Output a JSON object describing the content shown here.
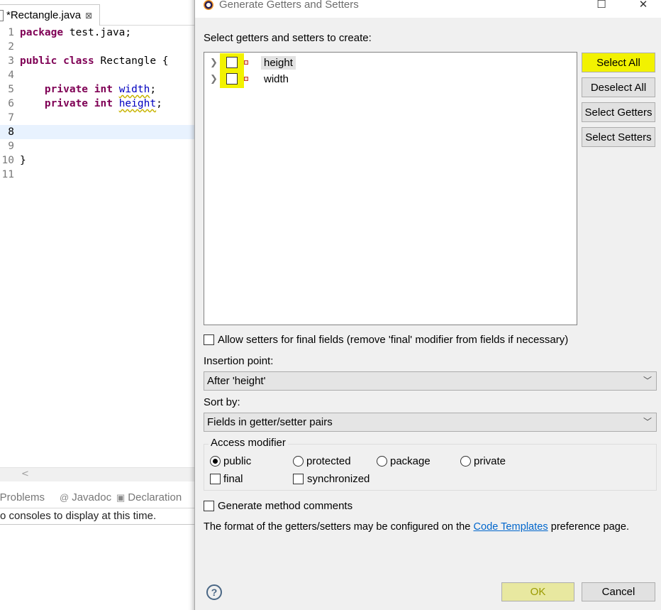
{
  "editor": {
    "tab_label": "*Rectangle.java",
    "tab_close": "⊠",
    "lines": [
      {
        "n": "1",
        "parts": [
          {
            "t": "package",
            "c": "kw"
          },
          {
            "t": " test.java;",
            "c": ""
          }
        ]
      },
      {
        "n": "2",
        "parts": []
      },
      {
        "n": "3",
        "parts": [
          {
            "t": "public",
            "c": "kw"
          },
          {
            "t": " ",
            "c": ""
          },
          {
            "t": "class",
            "c": "kw"
          },
          {
            "t": " Rectangle {",
            "c": ""
          }
        ]
      },
      {
        "n": "4",
        "parts": []
      },
      {
        "n": "5",
        "parts": [
          {
            "t": "    ",
            "c": ""
          },
          {
            "t": "private",
            "c": "kw"
          },
          {
            "t": " ",
            "c": ""
          },
          {
            "t": "int",
            "c": "kw"
          },
          {
            "t": " ",
            "c": ""
          },
          {
            "t": "width",
            "c": "fld"
          },
          {
            "t": ";",
            "c": ""
          }
        ]
      },
      {
        "n": "6",
        "parts": [
          {
            "t": "    ",
            "c": ""
          },
          {
            "t": "private",
            "c": "kw"
          },
          {
            "t": " ",
            "c": ""
          },
          {
            "t": "int",
            "c": "kw"
          },
          {
            "t": " ",
            "c": ""
          },
          {
            "t": "height",
            "c": "fld"
          },
          {
            "t": ";",
            "c": ""
          }
        ]
      },
      {
        "n": "7",
        "parts": []
      },
      {
        "n": "8",
        "parts": [],
        "current": true
      },
      {
        "n": "9",
        "parts": []
      },
      {
        "n": "10",
        "parts": [
          {
            "t": "}",
            "c": ""
          }
        ]
      },
      {
        "n": "11",
        "parts": []
      }
    ],
    "scroll_left_arrow": "<"
  },
  "bottom_panel": {
    "tabs": [
      {
        "icon": "!",
        "label": "Problems"
      },
      {
        "icon": "@",
        "label": "Javadoc"
      },
      {
        "icon": "▣",
        "label": "Declaration"
      }
    ],
    "console_message": "o consoles to display at this time."
  },
  "dialog": {
    "title": "Generate Getters and Setters",
    "window_buttons": {
      "maximize": "☐",
      "close": "✕"
    },
    "select_label": "Select getters and setters to create:",
    "fields": [
      {
        "name": "height",
        "checked": false,
        "selected": true
      },
      {
        "name": "width",
        "checked": false,
        "selected": false
      }
    ],
    "side_buttons": {
      "select_all": "Select All",
      "deselect_all": "Deselect All",
      "select_getters": "Select Getters",
      "select_setters": "Select Setters"
    },
    "allow_setters_final": {
      "label": "Allow setters for final fields (remove 'final' modifier from fields if necessary)",
      "checked": false
    },
    "insertion_point": {
      "label": "Insertion point:",
      "value": "After 'height'"
    },
    "sort_by": {
      "label": "Sort by:",
      "value": "Fields in getter/setter pairs"
    },
    "access_modifier": {
      "title": "Access modifier",
      "options": [
        "public",
        "protected",
        "package",
        "private"
      ],
      "selected": "public",
      "final_label": "final",
      "synchronized_label": "synchronized"
    },
    "generate_comments": {
      "label": "Generate method comments",
      "checked": false
    },
    "info": {
      "before": "The format of the getters/setters may be configured on the ",
      "link": "Code Templates",
      "after": " preference page."
    },
    "help_icon": "?",
    "ok_label": "OK",
    "cancel_label": "Cancel",
    "highlight_color": "#f2f200"
  }
}
